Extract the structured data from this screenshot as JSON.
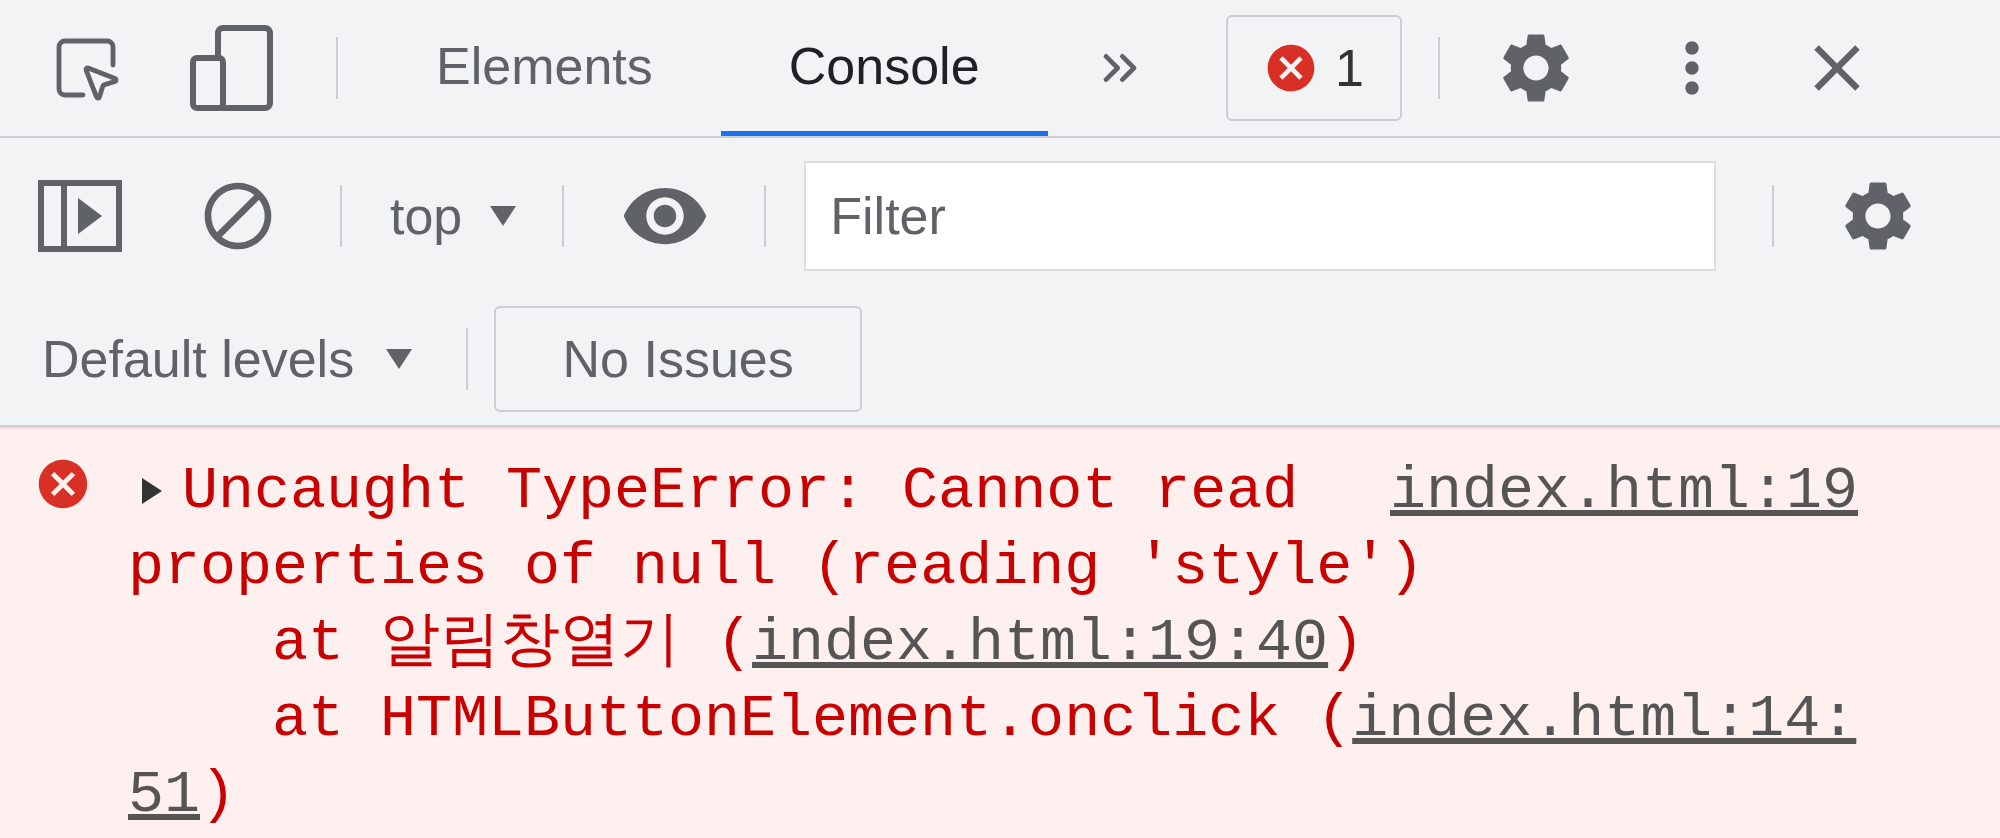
{
  "toolbar": {
    "tabs": [
      {
        "label": "Elements",
        "selected": false
      },
      {
        "label": "Console",
        "selected": true
      }
    ],
    "error_count": "1"
  },
  "console_toolbar": {
    "context": "top",
    "filter": {
      "placeholder": "Filter"
    }
  },
  "levels": {
    "label": "Default levels",
    "issues": "No Issues"
  },
  "messages": [
    {
      "kind": "error",
      "expanded": false,
      "source": "index.html:19",
      "lines": [
        "Uncaught TypeError: Cannot read",
        "properties of null (reading 'style')"
      ],
      "stack": [
        {
          "prefix": "at 알림창열기 (",
          "link": "index.html:19:40",
          "suffix": ")"
        },
        {
          "prefix": "at HTMLButtonElement.onclick (",
          "link": "index.html:14:",
          "link_wrap": "51",
          "suffix": ")"
        }
      ]
    }
  ]
}
